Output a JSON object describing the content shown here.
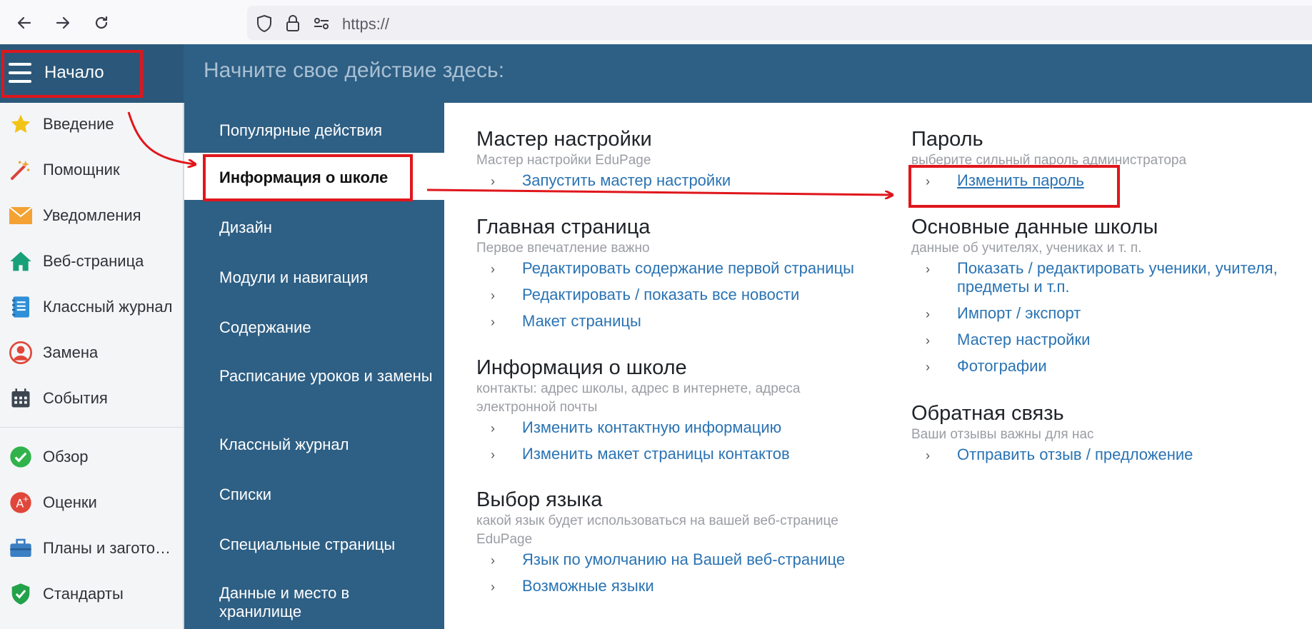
{
  "browser": {
    "url": "https://",
    "icons": {
      "back": "arrow-left-icon",
      "forward": "arrow-right-icon",
      "reload": "reload-icon",
      "shield": "shield-icon",
      "lock": "lock-icon",
      "permissions": "permissions-icon"
    }
  },
  "header": {
    "home_label": "Начало",
    "title": "Начните свое действие здесь:"
  },
  "sidebar": {
    "items": [
      {
        "label": "Введение",
        "icon": "star-icon"
      },
      {
        "label": "Помощник",
        "icon": "magic-wand-icon"
      },
      {
        "label": "Уведомления",
        "icon": "envelope-icon"
      },
      {
        "label": "Веб-страница",
        "icon": "house-icon"
      },
      {
        "label": "Классный журнал",
        "icon": "notebook-icon"
      },
      {
        "label": "Замена",
        "icon": "person-icon"
      },
      {
        "label": "События",
        "icon": "calendar-icon"
      },
      {
        "label": "Обзор",
        "icon": "checkmark-icon"
      },
      {
        "label": "Оценки",
        "icon": "grade-icon"
      },
      {
        "label": "Планы и заготовки",
        "icon": "briefcase-icon"
      },
      {
        "label": "Стандарты",
        "icon": "shield-check-icon"
      }
    ]
  },
  "menu": {
    "items": [
      {
        "label": "Популярные действия"
      },
      {
        "label": "Информация о школе"
      },
      {
        "label": "Дизайн"
      },
      {
        "label": "Модули и навигация"
      },
      {
        "label": "Содержание"
      },
      {
        "label": "Расписание уроков и замены"
      },
      {
        "label": "Классный журнал"
      },
      {
        "label": "Списки"
      },
      {
        "label": "Специальные страницы"
      },
      {
        "label": "Данные и место в хранилище"
      }
    ]
  },
  "content": {
    "left": [
      {
        "title": "Мастер настройки",
        "subtitle": "Мастер настройки EduPage",
        "links": [
          "Запустить мастер настройки"
        ]
      },
      {
        "title": "Главная страница",
        "subtitle": "Первое впечатление важно",
        "links": [
          "Редактировать содержание первой страницы",
          "Редактировать / показать все новости",
          "Макет страницы"
        ]
      },
      {
        "title": "Информация о школе",
        "subtitle": "контакты: адрес школы, адрес в интернете, адреса электронной почты",
        "links": [
          "Изменить контактную информацию",
          "Изменить макет страницы контактов"
        ]
      },
      {
        "title": "Выбор языка",
        "subtitle": "какой язык будет использоваться на вашей веб-странице EduPage",
        "links": [
          "Язык по умолчанию на Вашей веб-странице",
          "Возможные языки"
        ]
      }
    ],
    "right": [
      {
        "title": "Пароль",
        "subtitle": "выберите сильный пароль администратора",
        "links": [
          "Изменить пароль"
        ]
      },
      {
        "title": "Основные данные школы",
        "subtitle": "данные об учителях, учениках и т. п.",
        "links": [
          "Показать / редактировать ученики, учителя, предметы и т.п.",
          "Импорт / экспорт",
          "Мастер настройки",
          "Фотографии"
        ]
      },
      {
        "title": "Обратная связь",
        "subtitle": "Ваши отзывы важны для нас",
        "links": [
          "Отправить отзыв / предложение"
        ]
      }
    ]
  },
  "colors": {
    "header": "#2e5f84",
    "link": "#2a73b3",
    "annotation": "#e0161c"
  }
}
